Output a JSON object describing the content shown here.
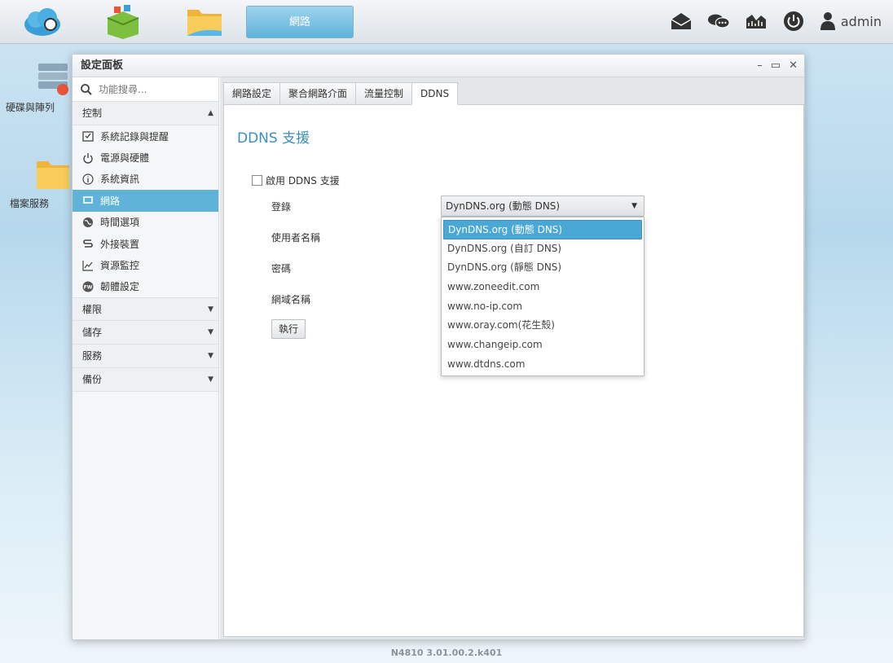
{
  "topbar": {
    "active_app": "網路",
    "user": "admin"
  },
  "desktop": {
    "icons": [
      {
        "label": "硬碟與陣列"
      },
      {
        "label": "檔案服務"
      }
    ]
  },
  "window": {
    "title": "設定面板",
    "controls": {
      "minimize": "–",
      "maximize": "▭",
      "close": "✕"
    }
  },
  "sidebar": {
    "search_placeholder": "功能搜尋...",
    "sections": [
      {
        "label": "控制",
        "expanded": true
      },
      {
        "label": "權限"
      },
      {
        "label": "儲存"
      },
      {
        "label": "服務"
      },
      {
        "label": "備份"
      }
    ],
    "items": [
      {
        "label": "系統記錄與提醒",
        "icon": "checklist-icon"
      },
      {
        "label": "電源與硬體",
        "icon": "power-icon"
      },
      {
        "label": "系統資訊",
        "icon": "info-icon"
      },
      {
        "label": "網路",
        "icon": "network-icon",
        "active": true
      },
      {
        "label": "時間選項",
        "icon": "globe-icon"
      },
      {
        "label": "外接裝置",
        "icon": "device-icon"
      },
      {
        "label": "資源監控",
        "icon": "chart-icon"
      },
      {
        "label": "韌體設定",
        "icon": "firmware-icon"
      }
    ]
  },
  "tabs": [
    {
      "label": "網路設定"
    },
    {
      "label": "聚合網路介面"
    },
    {
      "label": "流量控制"
    },
    {
      "label": "DDNS",
      "active": true
    }
  ],
  "ddns": {
    "title": "DDNS 支援",
    "enable_label": "啟用 DDNS 支援",
    "register_label": "登錄",
    "username_label": "使用者名稱",
    "password_label": "密碼",
    "domain_label": "網域名稱",
    "submit_label": "執行",
    "selected_provider": "DynDNS.org (動態 DNS)",
    "providers": [
      "DynDNS.org (動態 DNS)",
      "DynDNS.org (自訂 DNS)",
      "DynDNS.org (靜態 DNS)",
      "www.zoneedit.com",
      "www.no-ip.com",
      "www.oray.com(花生殼)",
      "www.changeip.com",
      "www.dtdns.com"
    ]
  },
  "footer": {
    "version": "N4810   3.01.00.2.k401"
  },
  "colors": {
    "accent": "#5fb3d9",
    "title": "#3a8fc0"
  }
}
